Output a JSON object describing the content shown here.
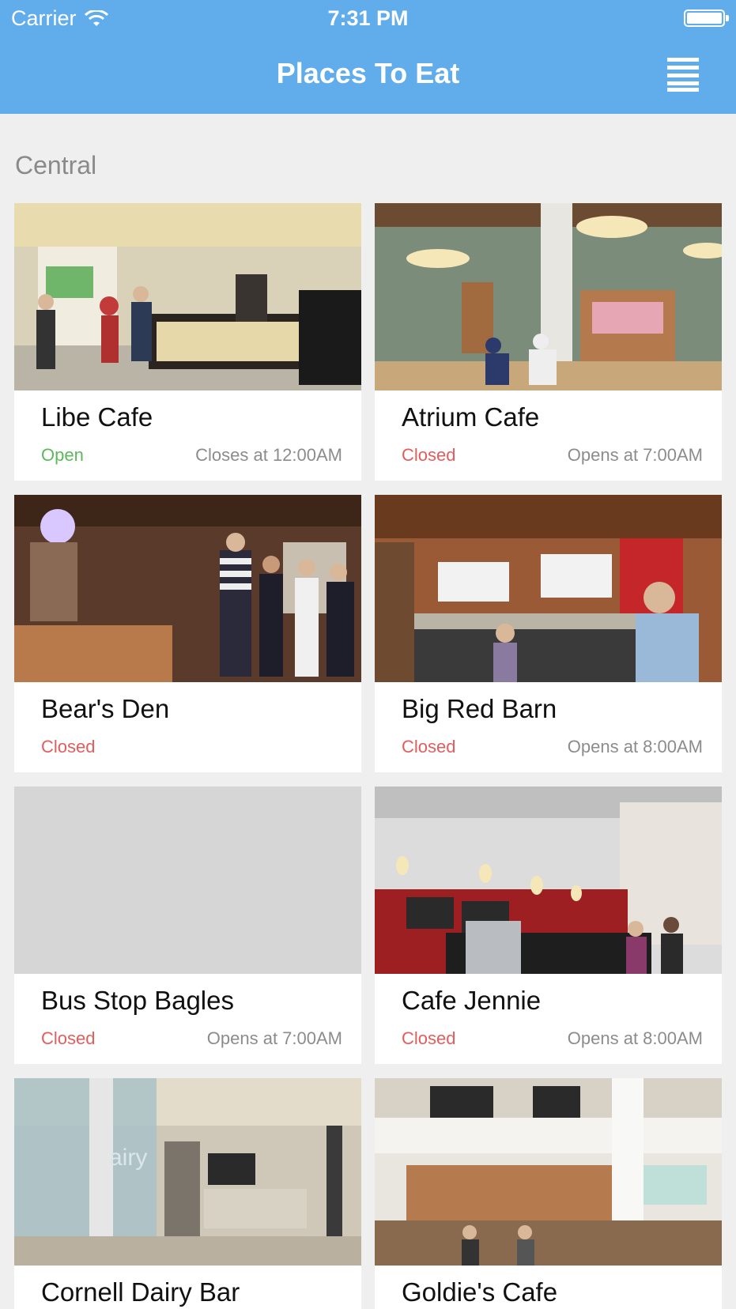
{
  "status_bar": {
    "carrier": "Carrier",
    "time": "7:31 PM"
  },
  "nav": {
    "title": "Places To Eat",
    "menu_icon": "hamburger-menu-icon"
  },
  "section": {
    "title": "Central"
  },
  "colors": {
    "header_blue": "#61acea",
    "open_green": "#5cb85c",
    "closed_red": "#e35d5d"
  },
  "places": [
    {
      "name": "Libe Cafe",
      "status": "Open",
      "hours": "Closes at 12:00AM"
    },
    {
      "name": "Atrium Cafe",
      "status": "Closed",
      "hours": "Opens at 7:00AM"
    },
    {
      "name": "Bear's Den",
      "status": "Closed",
      "hours": ""
    },
    {
      "name": "Big Red Barn",
      "status": "Closed",
      "hours": "Opens at 8:00AM"
    },
    {
      "name": "Bus Stop Bagles",
      "status": "Closed",
      "hours": "Opens at 7:00AM"
    },
    {
      "name": "Cafe Jennie",
      "status": "Closed",
      "hours": "Opens at 8:00AM"
    },
    {
      "name": "Cornell Dairy Bar",
      "status": "",
      "hours": ""
    },
    {
      "name": "Goldie's Cafe",
      "status": "",
      "hours": ""
    }
  ]
}
